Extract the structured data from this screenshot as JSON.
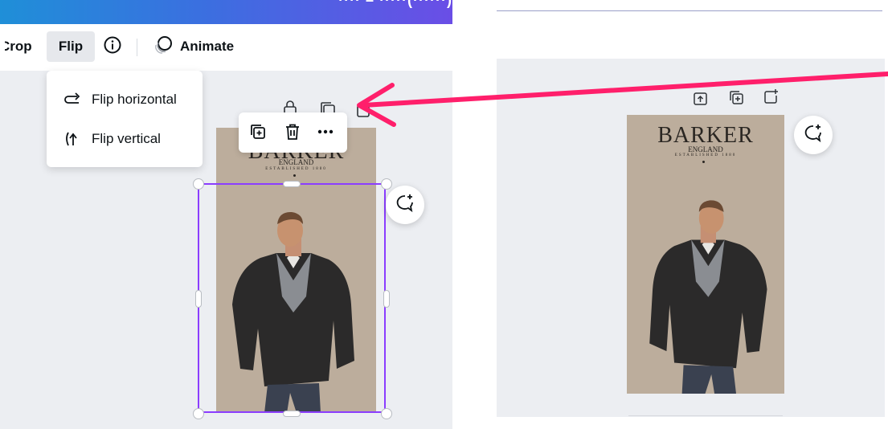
{
  "topbar": {
    "partial_text": "···· – ·····(······)"
  },
  "toolbar": {
    "crop_label": "Crop",
    "flip_label": "Flip",
    "info_icon": "info-icon",
    "animate_label": "Animate",
    "animate_icon": "animate-icon"
  },
  "flip_menu": {
    "items": [
      {
        "label": "Flip horizontal",
        "icon": "flip-horizontal-icon"
      },
      {
        "label": "Flip vertical",
        "icon": "flip-vertical-icon"
      }
    ]
  },
  "element_toolbar": {
    "icons": [
      "duplicate-icon",
      "trash-icon",
      "more-icon"
    ]
  },
  "page_icons": [
    "lock-icon",
    "duplicate-page-icon",
    "add-page-icon"
  ],
  "design": {
    "brand": "BARKER",
    "country": "ENGLAND",
    "established": "ESTABLISHED 1880"
  },
  "colors": {
    "accent": "#8b3dff",
    "arrow": "#ff1f6b",
    "page_background": "#bcad9c",
    "canvas": "#eceef2"
  }
}
